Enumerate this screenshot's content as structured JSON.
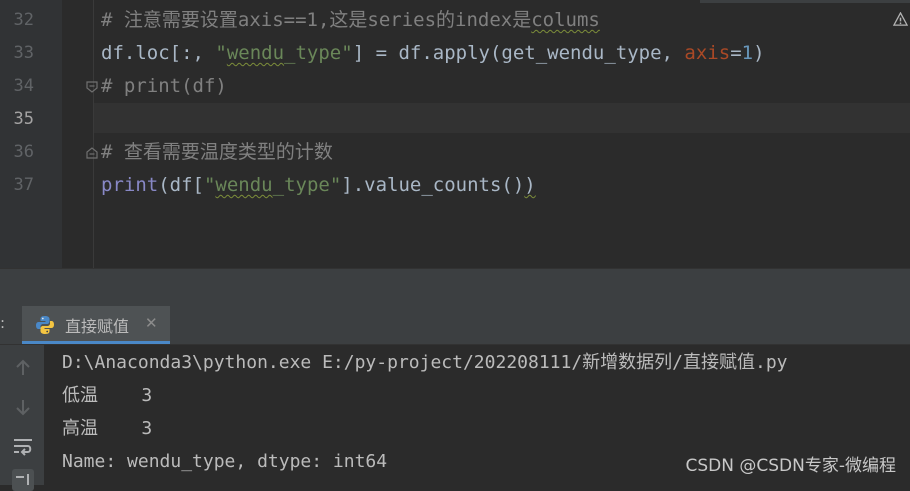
{
  "editor": {
    "lines": [
      {
        "num": "32",
        "parts": [
          {
            "t": "# 注意需要设置axis==1,这是series的index是",
            "c": "comment"
          },
          {
            "t": "colums",
            "c": "comment squig"
          }
        ]
      },
      {
        "num": "33",
        "parts": [
          {
            "t": "df.loc[:, ",
            "c": ""
          },
          {
            "t": "\"",
            "c": "str"
          },
          {
            "t": "wendu",
            "c": "str squig"
          },
          {
            "t": "_type\"",
            "c": "str"
          },
          {
            "t": "] = df.apply(get_wendu_type, ",
            "c": ""
          },
          {
            "t": "axis",
            "c": "kwarg"
          },
          {
            "t": "=",
            "c": ""
          },
          {
            "t": "1",
            "c": "num"
          },
          {
            "t": ")",
            "c": ""
          }
        ]
      },
      {
        "num": "34",
        "parts": [
          {
            "t": "# print(df)",
            "c": "comment"
          }
        ]
      },
      {
        "num": "35",
        "parts": []
      },
      {
        "num": "36",
        "parts": [
          {
            "t": "# 查看需要温度类型的计数",
            "c": "comment"
          }
        ]
      },
      {
        "num": "37",
        "parts": [
          {
            "t": "print",
            "c": "builtin"
          },
          {
            "t": "(df[",
            "c": ""
          },
          {
            "t": "\"",
            "c": "str"
          },
          {
            "t": "wendu",
            "c": "str squig"
          },
          {
            "t": "_type\"",
            "c": "str"
          },
          {
            "t": "].value_counts()",
            "c": ""
          },
          {
            "t": ")",
            "c": "squig"
          }
        ]
      }
    ],
    "current_line": "35"
  },
  "run_panel": {
    "tool_prefix": ":",
    "tab_label": "直接赋值",
    "close_glyph": "✕"
  },
  "console": {
    "lines": [
      "D:\\Anaconda3\\python.exe E:/py-project/202208111/新增数据列/直接赋值.py",
      "低温    3",
      "高温    3",
      "Name: wendu_type, dtype: int64"
    ]
  },
  "icons": {
    "fold": "fold-marker-icon",
    "warning": "warning-icon",
    "python": "python-icon",
    "rerun": "rerun-up-icon",
    "down": "scroll-down-icon",
    "wrap": "soft-wrap-icon",
    "sort": "scroll-to-end-icon"
  },
  "colors": {
    "background": "#2b2b2b",
    "comment": "#808080",
    "string": "#6a8759",
    "keyword_arg": "#aa4926",
    "number": "#6897bb",
    "builtin": "#8888c6",
    "tab_accent": "#4a88c7"
  },
  "watermark": "CSDN @CSDN专家-微编程"
}
